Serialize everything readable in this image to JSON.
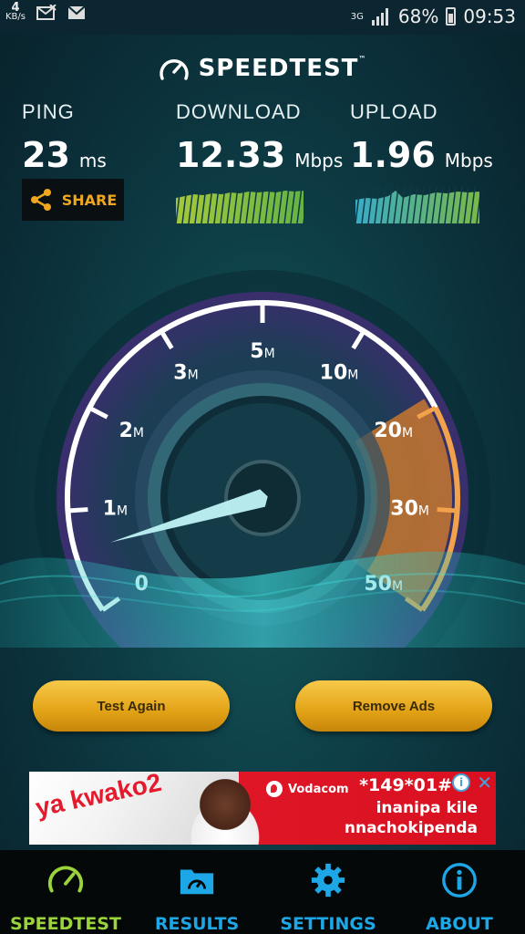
{
  "status_bar": {
    "net_speed_value": "4",
    "net_speed_unit": "KB/s",
    "network_type": "3G",
    "battery": "68%",
    "time": "09:53"
  },
  "app": {
    "title": "SPEEDTEST",
    "trademark": "™"
  },
  "metrics": {
    "ping": {
      "label": "PING",
      "value": "23",
      "unit": "ms"
    },
    "download": {
      "label": "DOWNLOAD",
      "value": "12.33",
      "unit": "Mbps"
    },
    "upload": {
      "label": "UPLOAD",
      "value": "1.96",
      "unit": "Mbps"
    }
  },
  "share_label": "SHARE",
  "gauge": {
    "ticks": [
      {
        "num": "0",
        "unit": ""
      },
      {
        "num": "1",
        "unit": "M"
      },
      {
        "num": "2",
        "unit": "M"
      },
      {
        "num": "3",
        "unit": "M"
      },
      {
        "num": "5",
        "unit": "M"
      },
      {
        "num": "10",
        "unit": "M"
      },
      {
        "num": "20",
        "unit": "M"
      },
      {
        "num": "30",
        "unit": "M"
      },
      {
        "num": "50",
        "unit": "M"
      }
    ],
    "needle_value": 0.6
  },
  "buttons": {
    "test_again": "Test Again",
    "remove_ads": "Remove Ads"
  },
  "ad": {
    "brand": "ya kwako2",
    "operator": "Vodacom",
    "code": "*149*01#",
    "line1": "inanipa kile",
    "line2": "nnachokipenda",
    "info": "i",
    "close": "✕"
  },
  "nav": {
    "items": [
      {
        "label": "SPEEDTEST",
        "icon": "speedometer-icon",
        "active": true
      },
      {
        "label": "RESULTS",
        "icon": "folder-gauge-icon",
        "active": false
      },
      {
        "label": "SETTINGS",
        "icon": "gear-icon",
        "active": false
      },
      {
        "label": "ABOUT",
        "icon": "info-icon",
        "active": false
      }
    ]
  },
  "colors": {
    "accent_green": "#9bd43a",
    "accent_blue": "#1ea7e6",
    "button_gold": "#e3a317",
    "share_orange": "#f0a61e"
  }
}
